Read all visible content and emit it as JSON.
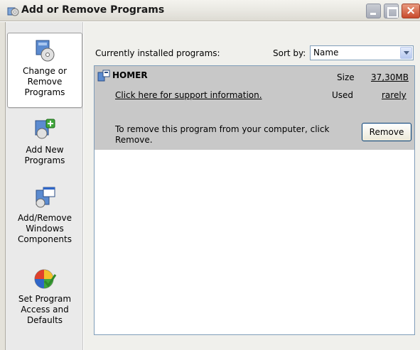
{
  "window": {
    "title": "Add or Remove Programs"
  },
  "sidebar": {
    "items": [
      {
        "label_line1": "Change or",
        "label_line2": "Remove",
        "label_line3": "Programs",
        "icon": "change-remove-programs-icon",
        "selected": true
      },
      {
        "label_line1": "Add New",
        "label_line2": "Programs",
        "icon": "add-new-programs-icon",
        "selected": false
      },
      {
        "label_line1": "Add/Remove",
        "label_line2": "Windows",
        "label_line3": "Components",
        "icon": "windows-components-icon",
        "selected": false
      },
      {
        "label_line1": "Set Program",
        "label_line2": "Access and",
        "label_line3": "Defaults",
        "icon": "program-access-icon",
        "selected": false
      }
    ]
  },
  "main": {
    "installed_label": "Currently installed programs:",
    "sort_label": "Sort by:",
    "sort_value": "Name"
  },
  "program": {
    "name": "HOMER",
    "size_label": "Size",
    "size_value": "37,30MB",
    "support_link": "Click here for support information.",
    "used_label": "Used",
    "used_value": "rarely",
    "remove_text": "To remove this program from your computer, click Remove.",
    "remove_button": "Remove"
  },
  "colors": {
    "selected_row": "#c8c8c8",
    "title_bar": "#e9e8e2",
    "close_button": "#c84a2c"
  }
}
